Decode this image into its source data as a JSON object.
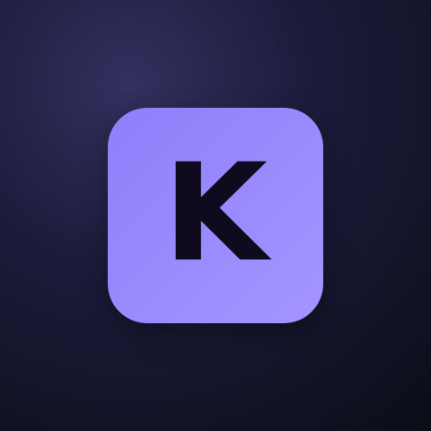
{
  "app_icon": {
    "letter": "K",
    "background_color_start": "#8d80fa",
    "background_color_end": "#a495ff",
    "letter_color": "#0f0a1e"
  },
  "page": {
    "background_center": "#34305f",
    "background_edge": "#0b0d17"
  }
}
